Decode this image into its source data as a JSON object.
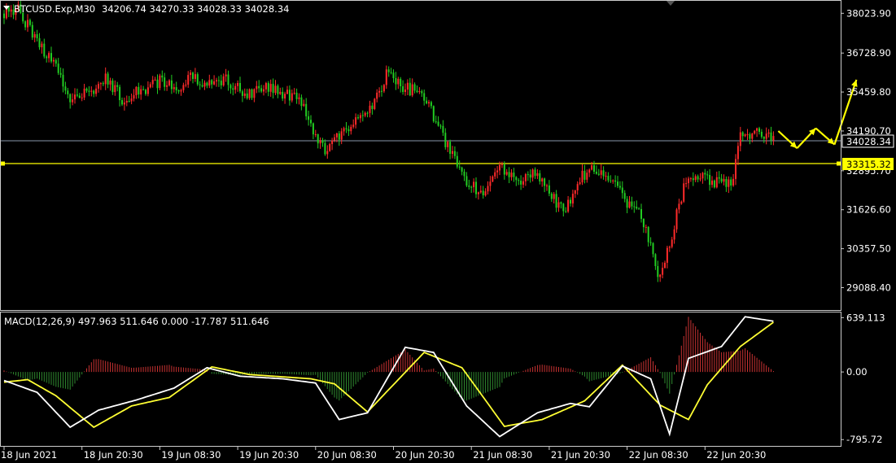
{
  "main_header": {
    "symbol": "BTCUSD.Exp,M30",
    "ohlc": "34206.74 34270.33 34028.33 34028.34"
  },
  "macd_header": {
    "label": "MACD(12,26,9) 497.963 511.646 0.000 -17.787 511.646"
  },
  "colors": {
    "background": "#000000",
    "bull": "#ff2a2a",
    "bear": "#22cc22",
    "level_line": "#ffff00",
    "price_line": "#8899aa",
    "macd_line": "#ffffff",
    "signal_line": "#ffff33",
    "arrows": "#ffff00",
    "border": "#cccccc",
    "hist_pos": "#c83232",
    "hist_neg": "#2f8a2f"
  },
  "chart_data": [
    {
      "type": "candlestick",
      "name": "price",
      "y_ticks": [
        38023.9,
        36728.9,
        35459.8,
        34190.7,
        32895.7,
        31626.6,
        30357.5,
        29088.4
      ],
      "y_tick_labels": [
        "38023.90",
        "36728.90",
        "35459.80",
        "34190.70",
        "32895.70",
        "31626.60",
        "30357.50",
        "29088.40"
      ],
      "ylim": [
        28360,
        38430
      ],
      "x_tick_labels": [
        "18 Jun 2021",
        "18 Jun 20:30",
        "19 Jun 08:30",
        "19 Jun 20:30",
        "20 Jun 08:30",
        "20 Jun 20:30",
        "21 Jun 08:30",
        "21 Jun 20:30",
        "22 Jun 08:30",
        "22 Jun 20:30"
      ],
      "current_price": 34028.34,
      "current_price_label": "34028.34",
      "level": 33315.32,
      "level_label": "33315.32",
      "close_anchors": [
        [
          0,
          38000
        ],
        [
          6,
          38200
        ],
        [
          10,
          37600
        ],
        [
          16,
          36900
        ],
        [
          22,
          36200
        ],
        [
          28,
          35300
        ],
        [
          36,
          35500
        ],
        [
          44,
          35900
        ],
        [
          50,
          35200
        ],
        [
          58,
          35500
        ],
        [
          66,
          35800
        ],
        [
          74,
          35600
        ],
        [
          80,
          36000
        ],
        [
          86,
          35700
        ],
        [
          94,
          35900
        ],
        [
          102,
          35400
        ],
        [
          110,
          35600
        ],
        [
          118,
          35400
        ],
        [
          126,
          35200
        ],
        [
          132,
          34100
        ],
        [
          136,
          33600
        ],
        [
          144,
          34200
        ],
        [
          150,
          34500
        ],
        [
          158,
          35300
        ],
        [
          162,
          36000
        ],
        [
          168,
          35700
        ],
        [
          176,
          35400
        ],
        [
          182,
          34700
        ],
        [
          188,
          33700
        ],
        [
          194,
          32700
        ],
        [
          202,
          32200
        ],
        [
          210,
          33000
        ],
        [
          218,
          32500
        ],
        [
          226,
          32800
        ],
        [
          232,
          32000
        ],
        [
          238,
          31700
        ],
        [
          244,
          32700
        ],
        [
          250,
          33000
        ],
        [
          258,
          32600
        ],
        [
          264,
          31800
        ],
        [
          270,
          31400
        ],
        [
          274,
          30400
        ],
        [
          278,
          29300
        ],
        [
          282,
          30500
        ],
        [
          288,
          32400
        ],
        [
          294,
          32800
        ],
        [
          302,
          32500
        ],
        [
          308,
          32400
        ],
        [
          312,
          34100
        ],
        [
          320,
          34100
        ],
        [
          326,
          34028
        ]
      ],
      "projection": [
        34190,
        33630,
        34280,
        33750,
        35860
      ]
    },
    {
      "type": "macd",
      "name": "MACD(12,26,9)",
      "fast": 12,
      "slow": 26,
      "signal": 9,
      "y_ticks": [
        639.113,
        0.0,
        -795.72
      ],
      "y_tick_labels": [
        "639.113",
        "0.00",
        "-795.72"
      ],
      "ylim": [
        -870,
        700
      ],
      "macd_anchors": [
        [
          0,
          -100
        ],
        [
          14,
          -240
        ],
        [
          28,
          -650
        ],
        [
          40,
          -450
        ],
        [
          56,
          -330
        ],
        [
          72,
          -190
        ],
        [
          86,
          50
        ],
        [
          100,
          -50
        ],
        [
          118,
          -80
        ],
        [
          132,
          -130
        ],
        [
          142,
          -560
        ],
        [
          154,
          -480
        ],
        [
          170,
          290
        ],
        [
          182,
          230
        ],
        [
          196,
          -400
        ],
        [
          210,
          -760
        ],
        [
          226,
          -480
        ],
        [
          240,
          -370
        ],
        [
          248,
          -410
        ],
        [
          262,
          70
        ],
        [
          274,
          -80
        ],
        [
          282,
          -730
        ],
        [
          290,
          160
        ],
        [
          304,
          300
        ],
        [
          314,
          650
        ],
        [
          326,
          597
        ]
      ],
      "signal_anchors": [
        [
          0,
          -120
        ],
        [
          10,
          -90
        ],
        [
          22,
          -280
        ],
        [
          38,
          -650
        ],
        [
          54,
          -400
        ],
        [
          70,
          -300
        ],
        [
          88,
          60
        ],
        [
          104,
          -30
        ],
        [
          130,
          -80
        ],
        [
          140,
          -140
        ],
        [
          154,
          -470
        ],
        [
          178,
          230
        ],
        [
          194,
          50
        ],
        [
          212,
          -640
        ],
        [
          228,
          -560
        ],
        [
          246,
          -340
        ],
        [
          262,
          80
        ],
        [
          278,
          -390
        ],
        [
          290,
          -560
        ],
        [
          298,
          -150
        ],
        [
          312,
          300
        ],
        [
          326,
          585
        ]
      ]
    }
  ]
}
